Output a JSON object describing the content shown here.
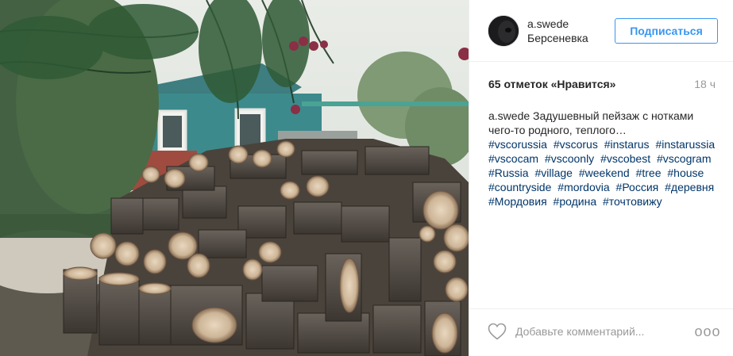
{
  "post": {
    "username": "a.swede",
    "location": "Берсеневка",
    "follow_label": "Подписаться",
    "likes": "65 отметок «Нравится»",
    "time": "18 ч",
    "caption": {
      "username": "a.swede",
      "text": "Задушевный пейзаж с нотками чего-то родного, теплого…",
      "hashtags": [
        "#vscorussia",
        "#vscorus",
        "#instarus",
        "#instarussia",
        "#vscocam",
        "#vscoonly",
        "#vscobest",
        "#vscogram",
        "#Russia",
        "#village",
        "#weekend",
        "#tree",
        "#house",
        "#countryside",
        "#mordovia",
        "#Россия",
        "#деревня",
        "#Мордовия",
        "#родина",
        "#точтовижу"
      ]
    },
    "comment_placeholder": "Добавьте комментарий...",
    "more_label": "ooo"
  },
  "colors": {
    "link": "#003569",
    "accent": "#3897f0",
    "muted": "#999999",
    "border": "#efefef"
  },
  "icons": {
    "like": "heart-outline-icon",
    "more": "more-options-icon"
  }
}
